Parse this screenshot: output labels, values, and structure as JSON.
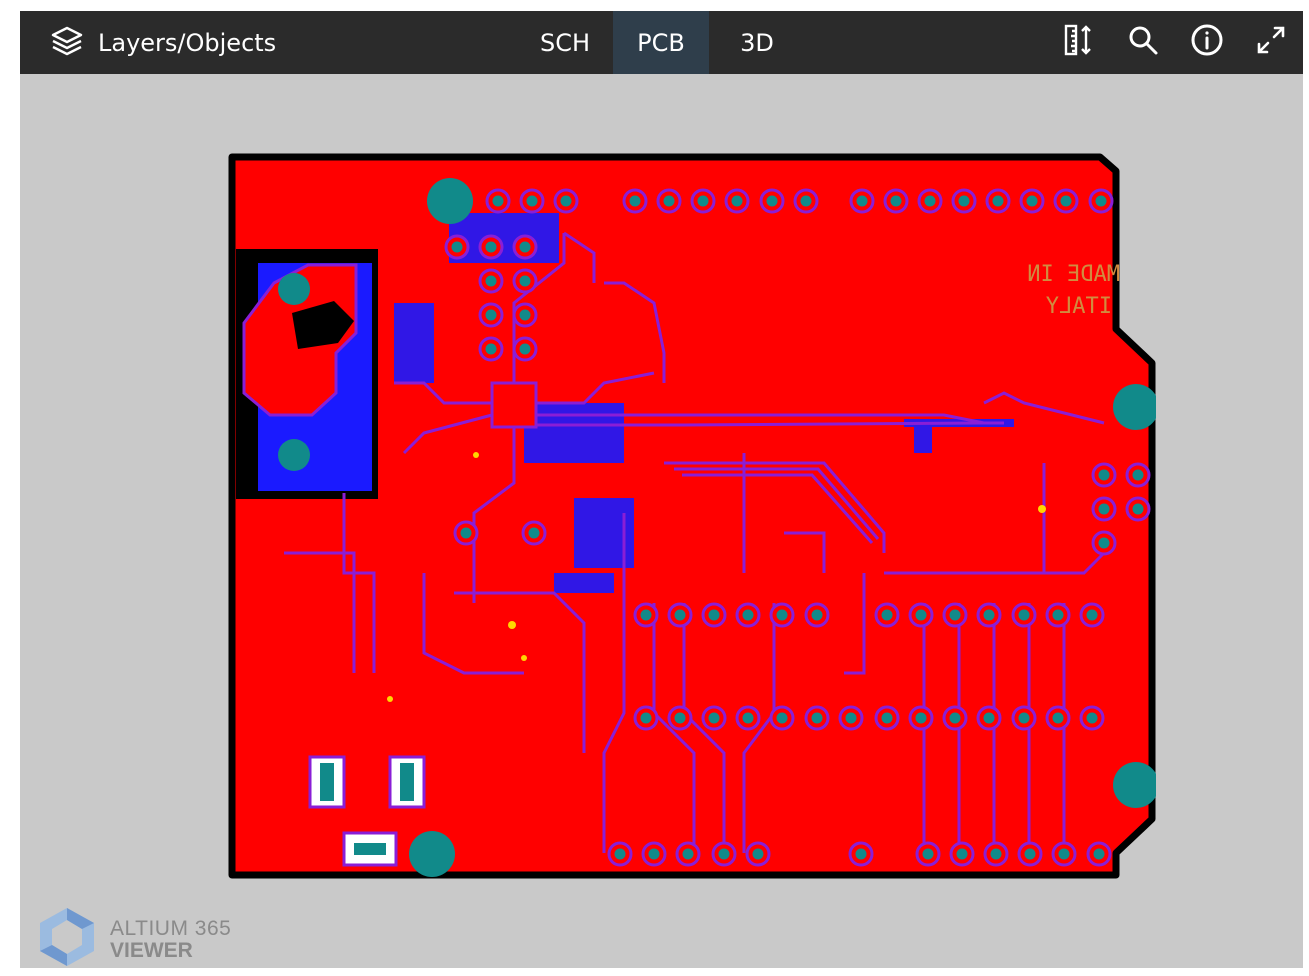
{
  "toolbar": {
    "layers_label": "Layers/Objects",
    "tabs": [
      {
        "label": "SCH",
        "active": false
      },
      {
        "label": "PCB",
        "active": true
      },
      {
        "label": "3D",
        "active": false
      }
    ],
    "tools": [
      "measure-icon",
      "search-icon",
      "info-icon",
      "fullscreen-icon"
    ]
  },
  "board": {
    "silkscreen_line1": "MADE IN",
    "silkscreen_line2": "ITALY",
    "colors": {
      "copper_top": "#ff0000",
      "copper_bottom": "#1a1aff",
      "trace": "#8a1ed6",
      "pad": "#118a8a",
      "outline": "#000000",
      "via": "#ffd700"
    }
  },
  "brand": {
    "line1": "ALTIUM 365",
    "line2": "VIEWER"
  }
}
